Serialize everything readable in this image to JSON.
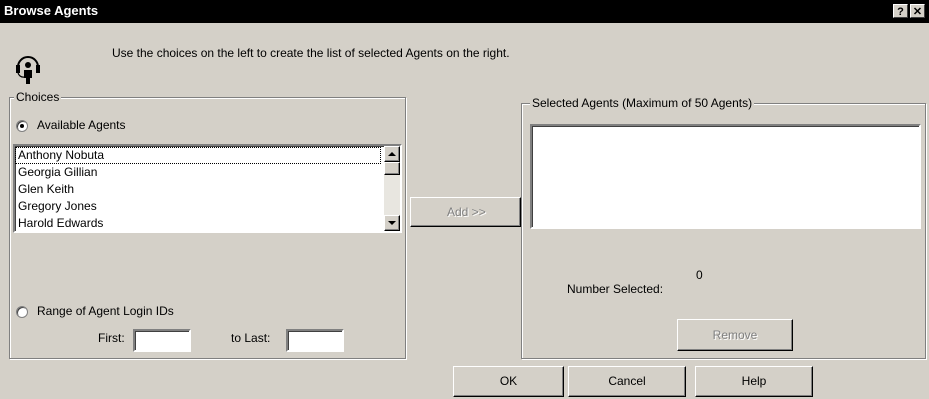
{
  "window": {
    "title": "Browse Agents",
    "help_glyph": "?",
    "close_glyph": "✕"
  },
  "instructions": "Use the choices on the left to create the list of selected Agents on the right.",
  "choices": {
    "legend": "Choices",
    "available_label": "Available Agents",
    "available_selected": true,
    "agents": [
      "Anthony Nobuta",
      "Georgia Gillian",
      "Glen Keith",
      "Gregory Jones",
      "Harold Edwards"
    ],
    "range_label": "Range of Agent Login IDs",
    "range_selected": false,
    "first_label": "First:",
    "first_value": "",
    "last_label": "to Last:",
    "last_value": ""
  },
  "add_button": "Add >>",
  "selected": {
    "legend": "Selected Agents (Maximum of 50 Agents)",
    "items": [],
    "count_label": "Number Selected:",
    "count_value": "0",
    "remove_button": "Remove"
  },
  "footer": {
    "ok": "OK",
    "cancel": "Cancel",
    "help": "Help"
  },
  "icons": [
    "agent-headset-icon",
    "help-icon",
    "close-icon",
    "scroll-up-icon",
    "scroll-down-icon"
  ],
  "colors": {
    "face": "#d4d0c8",
    "titlebar": "#000000",
    "field": "#ffffff"
  }
}
